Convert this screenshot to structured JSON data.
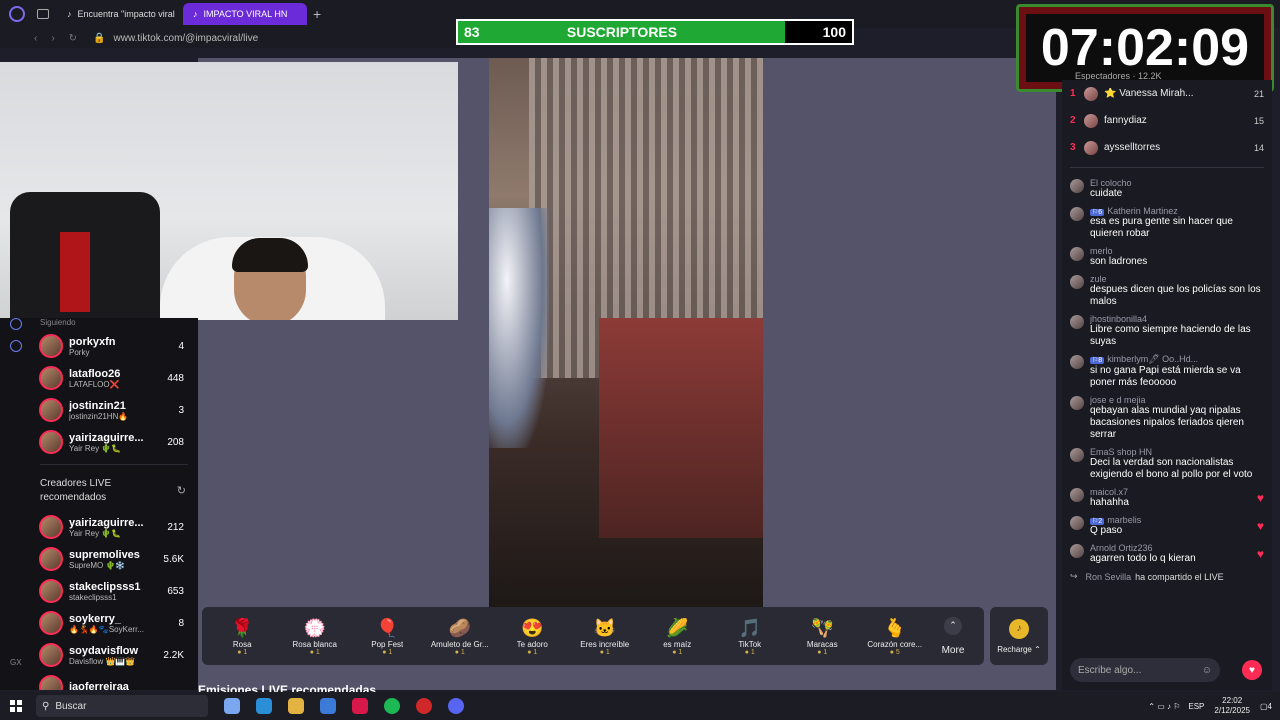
{
  "browser": {
    "tabs": [
      {
        "label": "Encuentra \"impacto viral\"",
        "active": false
      },
      {
        "label": "IMPACTO VIRAL HN",
        "active": true
      }
    ],
    "url": "www.tiktok.com/@impacviral/live"
  },
  "subscribers": {
    "current": "83",
    "label": "SUSCRIPTORES",
    "goal": "100",
    "progress": 0.83
  },
  "timer": {
    "value": "07:02:09",
    "spectators_label": "Espectadores · 12.2K"
  },
  "sidebar": {
    "top_label": "Siguiendo",
    "following": [
      {
        "name": "porkyxfn",
        "sub": "Porky",
        "count": "4"
      },
      {
        "name": "latafloo26",
        "sub": "LATAFLOO❌",
        "count": "448"
      },
      {
        "name": "jostinzin21",
        "sub": "jostinzin21HN🔥",
        "count": "3"
      },
      {
        "name": "yairizaguirre...",
        "sub": "Yair Rey 🌵🐛",
        "count": "208"
      }
    ],
    "rec_title": "Creadores LIVE recomendados",
    "recommended": [
      {
        "name": "yairizaguirre...",
        "sub": "Yair Rey 🌵🐛",
        "count": "212"
      },
      {
        "name": "supremolives",
        "sub": "SupreMO 🌵❄️",
        "count": "5.6K"
      },
      {
        "name": "stakeclipsss1",
        "sub": "stakeclipsss1",
        "count": "653"
      },
      {
        "name": "soykerry_",
        "sub": "🔥💃🔥🐾SoyKerr...",
        "count": "8"
      },
      {
        "name": "soydavisflow",
        "sub": "Davisflow 👑🎹👑",
        "count": "2.2K"
      },
      {
        "name": "iaoferreiraa",
        "sub": "",
        "count": ""
      }
    ]
  },
  "gifts": [
    {
      "icon": "🌹",
      "name": "Rosa",
      "cost": "1"
    },
    {
      "icon": "💮",
      "name": "Rosa blanca",
      "cost": "1"
    },
    {
      "icon": "🎈",
      "name": "Pop Fest",
      "cost": "1"
    },
    {
      "icon": "🥔",
      "name": "Amuleto de Gr...",
      "cost": "1"
    },
    {
      "icon": "😍",
      "name": "Te adoro",
      "cost": "1"
    },
    {
      "icon": "🐱",
      "name": "Eres increíble",
      "cost": "1"
    },
    {
      "icon": "🌽",
      "name": "es maíz",
      "cost": "1"
    },
    {
      "icon": "🎵",
      "name": "TikTok",
      "cost": "1"
    },
    {
      "icon": "🪇",
      "name": "Maracas",
      "cost": "1"
    },
    {
      "icon": "🫰",
      "name": "Corazón core...",
      "cost": "5"
    }
  ],
  "more_label": "More",
  "recharge_label": "Recharge ⌃",
  "recommended_title": "Emisiones LIVE recomendadas",
  "ranking": [
    {
      "rank": "1",
      "name": "⭐ Vanessa Mirah...",
      "score": "21"
    },
    {
      "rank": "2",
      "name": "fannydiaz",
      "score": "15"
    },
    {
      "rank": "3",
      "name": "aysselltorres",
      "score": "14"
    }
  ],
  "messages": [
    {
      "user": "El colocho",
      "level": "",
      "text": "cuidate",
      "heart": false
    },
    {
      "user": "Katherin Martinez",
      "level": "6",
      "text": "esa es pura gente sin hacer que quieren robar",
      "heart": false
    },
    {
      "user": "merlo",
      "level": "",
      "text": "son ladrones",
      "heart": false
    },
    {
      "user": "zule",
      "level": "",
      "text": "despues dicen que los policías son los malos",
      "heart": false
    },
    {
      "user": "jhostinbonilla4",
      "level": "",
      "text": "Libre como siempre haciendo de las suyas",
      "heart": false
    },
    {
      "user": "kimberlym🖊 Oo..Hd...",
      "level": "8",
      "text": "si no gana Papi está mierda se va poner más feooooo",
      "heart": false
    },
    {
      "user": "jose e d mejia",
      "level": "",
      "text": "qebayan alas mundial yaq nipalas bacasiones nipalos feriados qieren serrar",
      "heart": false
    },
    {
      "user": "EmaS shop HN",
      "level": "",
      "text": "Deci la verdad son nacionalistas exigiendo el bono al pollo por el voto",
      "heart": false
    },
    {
      "user": "maicol.x7",
      "level": "",
      "text": "hahahha",
      "heart": true
    },
    {
      "user": "marbelis",
      "level": "2",
      "text": "Q paso",
      "heart": true
    },
    {
      "user": "Arnold Ortiz236",
      "level": "",
      "text": "agarren todo lo q kieran",
      "heart": true
    }
  ],
  "shared": {
    "user": "Ron Sevilla",
    "text": "ha compartido el LIVE"
  },
  "chat_placeholder": "Escribe algo...",
  "taskbar": {
    "search": "Buscar",
    "lang": "ESP",
    "time": "22:02",
    "date": "2/12/2025",
    "notif": "4"
  }
}
